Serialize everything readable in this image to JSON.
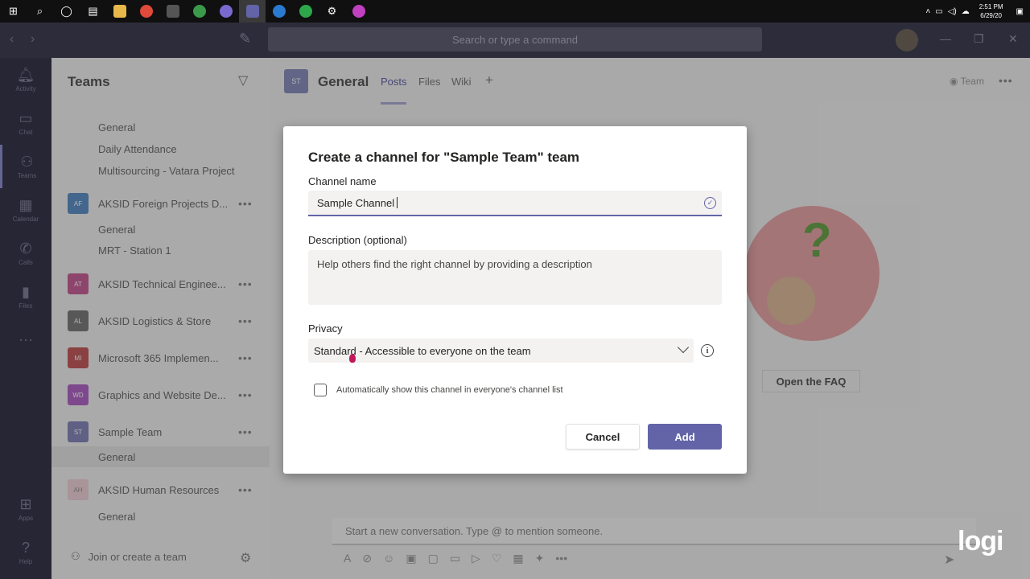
{
  "taskbar": {
    "time": "2:51 PM",
    "date": "6/29/20",
    "icons": [
      "windows-icon",
      "search-icon",
      "task-view-icon",
      "taskview-icon",
      "file-explorer-icon",
      "chrome-icon",
      "calculator-icon",
      "app-icon",
      "app-icon",
      "teams-icon",
      "app-icon",
      "app-icon",
      "settings-icon",
      "app-icon"
    ]
  },
  "header": {
    "search_placeholder": "Search or type a command"
  },
  "appbar": {
    "items": [
      {
        "label": "Activity",
        "icon": "bell-icon"
      },
      {
        "label": "Chat",
        "icon": "chat-icon"
      },
      {
        "label": "Teams",
        "icon": "teams-icon"
      },
      {
        "label": "Calendar",
        "icon": "calendar-icon"
      },
      {
        "label": "Calls",
        "icon": "phone-icon"
      },
      {
        "label": "Files",
        "icon": "file-icon"
      },
      {
        "label": "Apps",
        "icon": "apps-icon"
      },
      {
        "label": "Help",
        "icon": "help-icon"
      }
    ]
  },
  "teams_pane": {
    "title": "Teams",
    "channels_top": [
      "General",
      "Daily Attendance",
      "Multisourcing - Vatara Project"
    ],
    "teams": [
      {
        "initials": "AF",
        "name": "AKSID Foreign Projects D...",
        "color": "#2e6fb5"
      },
      {
        "initials": "AT",
        "name": "AKSID Technical Enginee...",
        "color": "#b8327a"
      },
      {
        "initials": "AL",
        "name": "AKSID Logistics & Store",
        "color": "#555555"
      },
      {
        "initials": "MI",
        "name": "Microsoft 365 Implemen...",
        "color": "#b32b2b"
      },
      {
        "initials": "WD",
        "name": "Graphics and Website De...",
        "color": "#9b3ab5"
      },
      {
        "initials": "ST",
        "name": "Sample Team",
        "color": "#6264a7"
      },
      {
        "initials": "AH",
        "name": "AKSID Human Resources",
        "color": "#e8c5cc"
      }
    ],
    "channels_af": [
      "General",
      "MRT - Station 1"
    ],
    "channel_st": "General",
    "channel_ah": "General",
    "join_label": "Join or create a team"
  },
  "main": {
    "channel_initials": "ST",
    "channel_title": "General",
    "tabs": [
      "Posts",
      "Files",
      "Wiki"
    ],
    "team_button": "Team",
    "faq_button": "Open the FAQ",
    "compose_placeholder": "Start a new conversation. Type @ to mention someone.",
    "logo": "logi"
  },
  "dialog": {
    "title": "Create a channel for \"Sample Team\" team",
    "name_label": "Channel name",
    "name_value": "Sample Channel",
    "desc_label": "Description (optional)",
    "desc_placeholder": "Help others find the right channel by providing a description",
    "privacy_label": "Privacy",
    "privacy_value": "Standard - Accessible to everyone on the team",
    "checkbox_label": "Automatically show this channel in everyone's channel list",
    "cancel_label": "Cancel",
    "add_label": "Add"
  },
  "colors": {
    "accent": "#6264a7",
    "header": "#3c3b4f",
    "appbar": "#36354a"
  }
}
